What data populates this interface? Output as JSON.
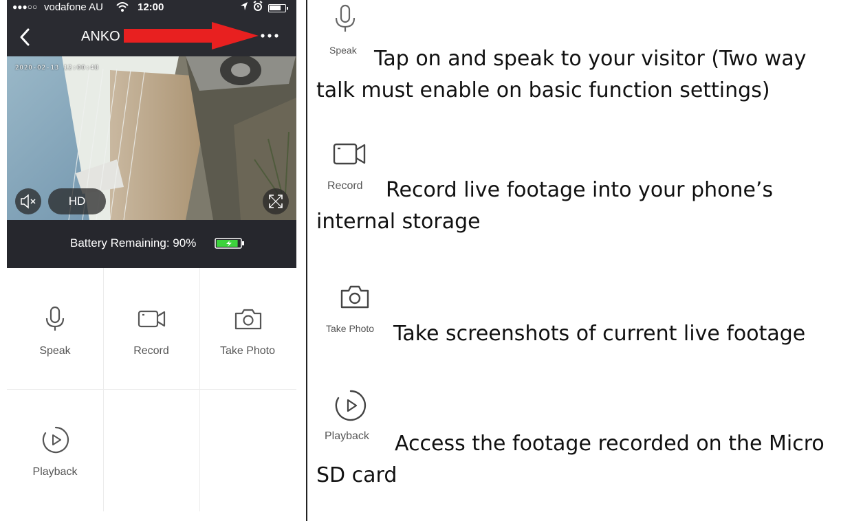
{
  "status_bar": {
    "signal_dots": "●●●○○",
    "carrier": "vodafone AU",
    "time": "12:00"
  },
  "nav": {
    "title": "ANKO"
  },
  "video": {
    "timestamp": "2020-02-13 12:00:48",
    "quality_label": "HD"
  },
  "battery": {
    "text": "Battery Remaining: 90%",
    "level": 0.9
  },
  "controls": [
    {
      "label": "Speak",
      "icon": "microphone-icon"
    },
    {
      "label": "Record",
      "icon": "video-camera-icon"
    },
    {
      "label": "Take Photo",
      "icon": "camera-icon"
    },
    {
      "label": "Playback",
      "icon": "play-circle-icon"
    }
  ],
  "features": [
    {
      "label": "Speak",
      "icon": "microphone-icon",
      "description": "Tap on and speak to your visitor (Two way talk must enable on basic function settings)"
    },
    {
      "label": "Record",
      "icon": "video-camera-icon",
      "description": "Record live footage into your phone’s internal storage"
    },
    {
      "label": "Take Photo",
      "icon": "camera-icon",
      "description": "Take screenshots of current live footage"
    },
    {
      "label": "Playback",
      "icon": "play-circle-icon",
      "description": "Access the footage recorded on the Micro SD card"
    }
  ],
  "colors": {
    "header_bg": "#2a2b31",
    "annotation_arrow": "#e82020",
    "battery_green": "#3dd33d"
  }
}
